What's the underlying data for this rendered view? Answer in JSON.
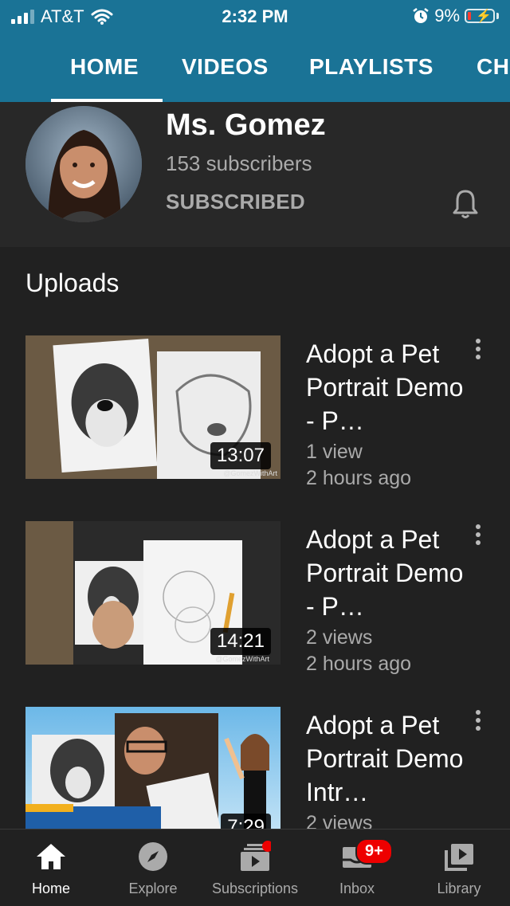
{
  "status_bar": {
    "carrier": "AT&T",
    "time": "2:32 PM",
    "battery": "9%"
  },
  "tabs": [
    "HOME",
    "VIDEOS",
    "PLAYLISTS",
    "CH"
  ],
  "channel": {
    "name": "Ms. Gomez",
    "subscribers": "153 subscribers",
    "subscribe_state": "SUBSCRIBED"
  },
  "uploads": {
    "title": "Uploads",
    "videos": [
      {
        "title": "Adopt a Pet Portrait Demo - P…",
        "duration": "13:07",
        "views": "1 view",
        "age": "2 hours ago",
        "watermark": "@GomezWithArt"
      },
      {
        "title": "Adopt a Pet Portrait Demo - P…",
        "duration": "14:21",
        "views": "2 views",
        "age": "2 hours ago",
        "watermark": "@GomezWithArt"
      },
      {
        "title": "Adopt a Pet Portrait Demo Intr…",
        "duration": "7:29",
        "views": "2 views",
        "age": ""
      }
    ]
  },
  "bottom_nav": [
    {
      "label": "Home",
      "icon": "home-icon",
      "active": true
    },
    {
      "label": "Explore",
      "icon": "compass-icon"
    },
    {
      "label": "Subscriptions",
      "icon": "subscriptions-icon"
    },
    {
      "label": "Inbox",
      "icon": "inbox-icon",
      "badge": "9+"
    },
    {
      "label": "Library",
      "icon": "library-icon"
    }
  ],
  "colors": {
    "header": "#1a7396",
    "background": "#212121",
    "badge": "#ee0000"
  }
}
